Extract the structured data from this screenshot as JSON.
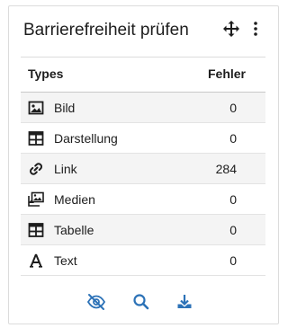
{
  "widget": {
    "title": "Barrierefreiheit prüfen",
    "icons": {
      "move": "move-arrows-icon",
      "menu": "vertical-ellipsis-icon"
    }
  },
  "table": {
    "columns": {
      "type": "Types",
      "errors": "Fehler"
    },
    "rows": [
      {
        "icon": "image-icon",
        "label": "Bild",
        "value": "0"
      },
      {
        "icon": "layout-icon",
        "label": "Darstellung",
        "value": "0"
      },
      {
        "icon": "link-icon",
        "label": "Link",
        "value": "284"
      },
      {
        "icon": "media-icon",
        "label": "Medien",
        "value": "0"
      },
      {
        "icon": "table-icon",
        "label": "Tabelle",
        "value": "0"
      },
      {
        "icon": "text-icon",
        "label": "Text",
        "value": "0"
      }
    ]
  },
  "footer": {
    "actions": [
      "eye-slash-icon",
      "search-icon",
      "download-icon"
    ],
    "accent": "#2c72b7"
  }
}
